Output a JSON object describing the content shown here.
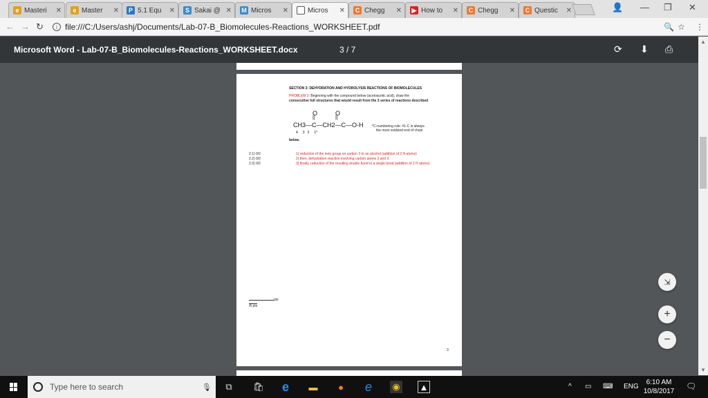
{
  "browser": {
    "tabs": [
      {
        "label": "Masteri",
        "color": "#e0a020",
        "glyph": "e",
        "active": false
      },
      {
        "label": "Master",
        "color": "#e0a020",
        "glyph": "e",
        "active": false
      },
      {
        "label": "5.1 Equ",
        "color": "#2878c8",
        "glyph": "P",
        "active": false
      },
      {
        "label": "Sakai @",
        "color": "#3a8ad0",
        "glyph": "S",
        "active": false
      },
      {
        "label": "Micros",
        "color": "#3a8ad0",
        "glyph": "M",
        "active": false
      },
      {
        "label": "Micros",
        "color": "#ffffff",
        "glyph": "",
        "active": true
      },
      {
        "label": "Chegg",
        "color": "#f07830",
        "glyph": "C",
        "active": false
      },
      {
        "label": "How to",
        "color": "#e02020",
        "glyph": "▶",
        "active": false
      },
      {
        "label": "Chegg",
        "color": "#f07830",
        "glyph": "C",
        "active": false
      },
      {
        "label": "Questic",
        "color": "#f07830",
        "glyph": "C",
        "active": false
      }
    ],
    "tab_close": "✕",
    "url": "file:///C:/Users/ashj/Documents/Lab-07-B_Biomolecules-Reactions_WORKSHEET.pdf"
  },
  "viewer": {
    "title": "Microsoft Word - Lab-07-B_Biomolecules-Reactions_WORKSHEET.docx",
    "page_indicator": "3 / 7"
  },
  "document": {
    "section_heading": "SECTION 3: DEHYDRATION AND HYDROLYSIS REACTIONS OF BIOMOLECULES",
    "problem_label": "PROBLEM 2:",
    "problem_text": " Beginning with the compound below (acetoacetic acid), draw the",
    "problem_text2": "consecutive full structures that would result from the 3 series of reactions described",
    "molecule": {
      "o1": "O",
      "o2": "O",
      "bond1": "||",
      "bond2": "||",
      "formula": "CH3—C—CH2—C—O-H",
      "numbers": "4     3   2     1*"
    },
    "c_note_line1": "*C-numbering rule: #1-C is always",
    "c_note_line2": "the most oxidized end of chain",
    "below": "below.",
    "scores": [
      "2.1) 0/2",
      "2.2) 0/2",
      "2.3) 0/2"
    ],
    "steps": [
      "1) reduction of the keto group on carbon 3 to an alcohol (addition of 2 H atoms)",
      "2) then, dehydration reaction involving carbon atoms 2 and 3",
      "3) finally, reduction of the resulting double bond to a single bond (addition of 2 H atoms)"
    ],
    "pts_label": "pts",
    "total_label": "/6 pts",
    "page_number": "3"
  },
  "taskbar": {
    "search_placeholder": "Type here to search",
    "language": "ENG",
    "time": "6:10 AM",
    "date": "10/8/2017"
  }
}
